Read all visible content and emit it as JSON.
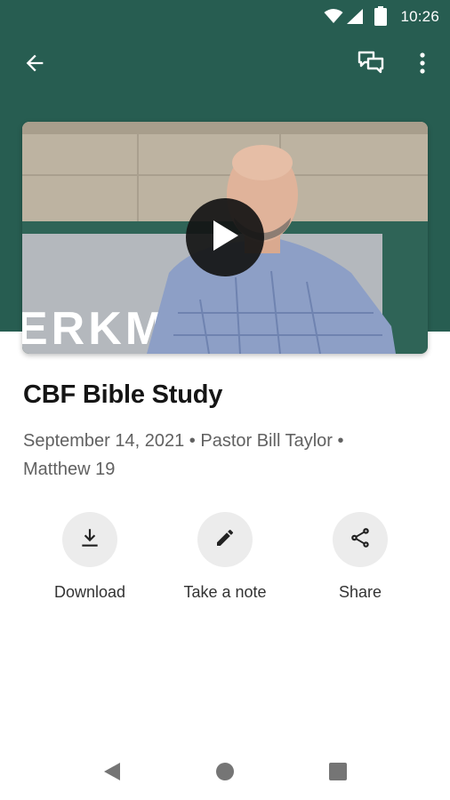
{
  "status_bar": {
    "time": "10:26"
  },
  "app_bar": {
    "back_icon": "arrow-left-icon",
    "chat_icon": "chat-bubbles-icon",
    "more_icon": "more-vert-icon"
  },
  "video": {
    "play_icon": "play-icon",
    "thumbnail_sign_text": "ERKM"
  },
  "sermon": {
    "title": "CBF Bible Study",
    "meta_line1": "September 14, 2021 • Pastor Bill Taylor •",
    "meta_line2": "Matthew 19"
  },
  "actions": [
    {
      "label": "Download",
      "icon": "download-icon"
    },
    {
      "label": "Take a note",
      "icon": "pencil-icon"
    },
    {
      "label": "Share",
      "icon": "share-icon"
    }
  ],
  "colors": {
    "header": "#275d51",
    "action_circle": "#ececec",
    "meta_text": "#616161"
  }
}
